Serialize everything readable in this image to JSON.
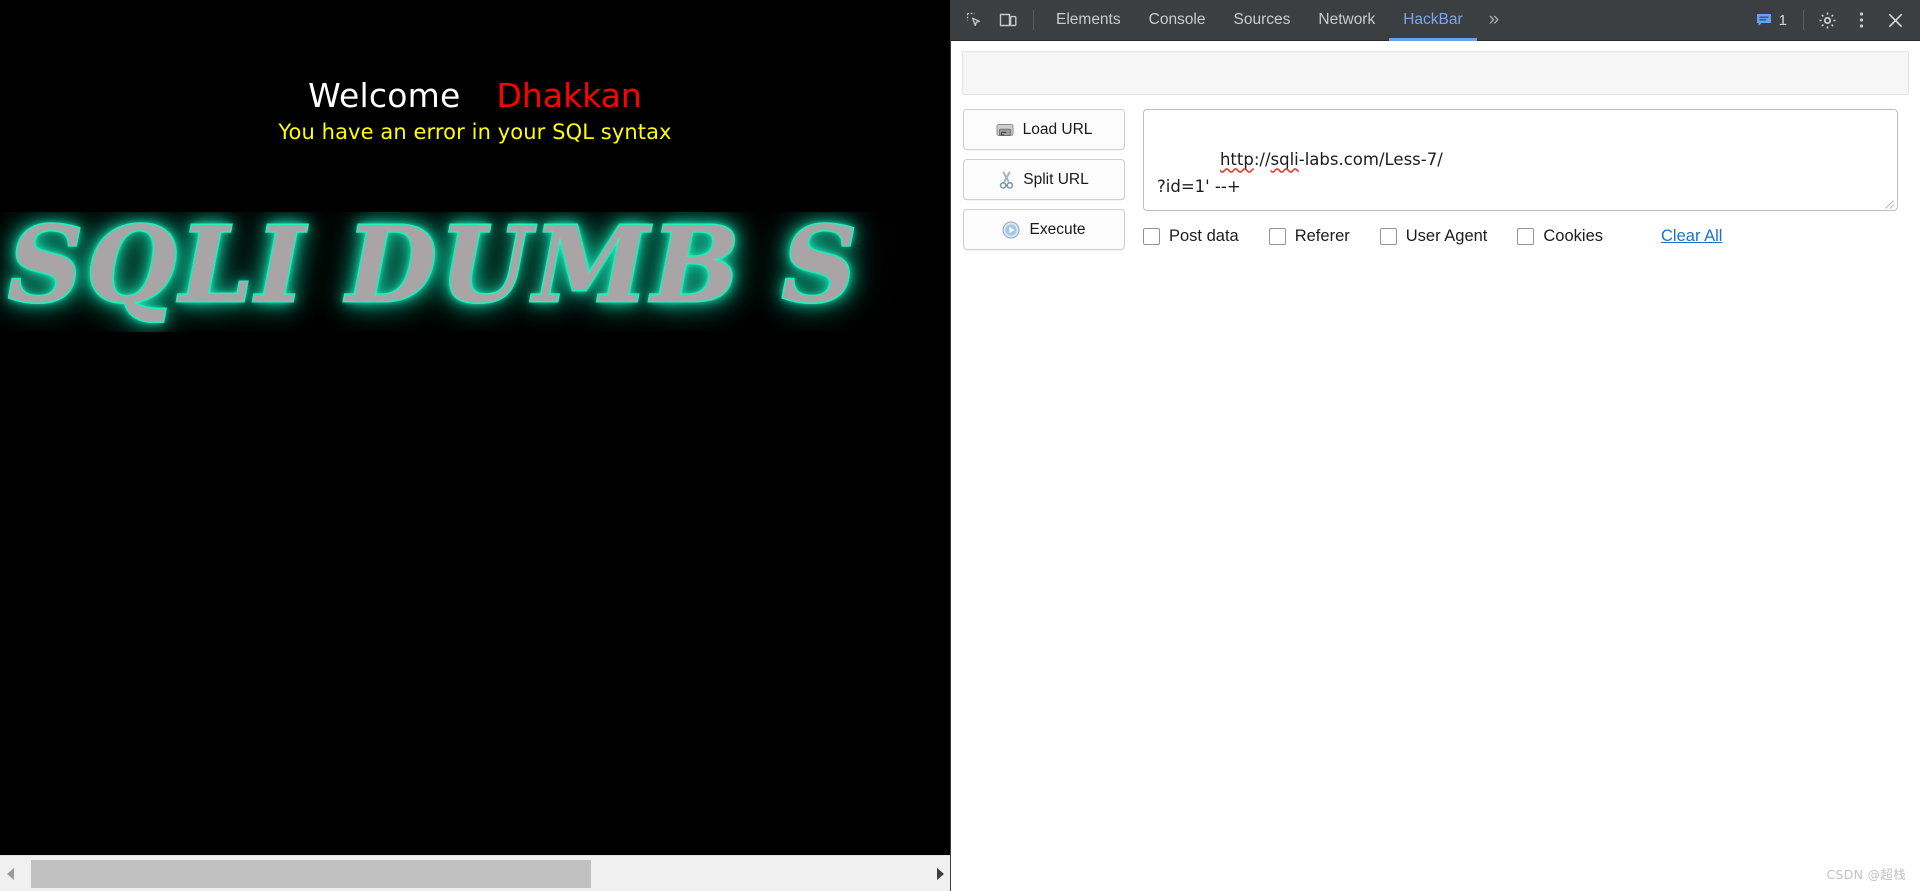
{
  "page": {
    "heading": {
      "welcome": "Welcome",
      "name": "Dhakkan"
    },
    "error_message": "You have an error in your SQL syntax",
    "banner_text": "SQLI DUMB S",
    "banner_colors": {
      "glow": "#2affc8",
      "metal": "#a9a4a6",
      "background": "#000000"
    },
    "text_colors": {
      "welcome": "#ffffff",
      "name": "#ff0000",
      "error": "#ffff00"
    },
    "scrollbar": {
      "left_arrow_icon": "chevron-left-icon",
      "right_arrow_icon": "chevron-right-icon"
    }
  },
  "devtools": {
    "toolbar": {
      "inspect_icon": "inspect-element-icon",
      "device_icon": "device-toolbar-icon",
      "tabs": [
        {
          "label": "Elements",
          "active": false
        },
        {
          "label": "Console",
          "active": false
        },
        {
          "label": "Sources",
          "active": false
        },
        {
          "label": "Network",
          "active": false
        },
        {
          "label": "HackBar",
          "active": true
        }
      ],
      "more_tabs_icon": "chevron-double-right-icon",
      "message_icon": "message-badge-icon",
      "message_count": "1",
      "settings_icon": "gear-icon",
      "menu_icon": "kebab-menu-icon",
      "close_icon": "close-icon",
      "active_tab_accent": "#6b9eeb",
      "background": "#3c3f41"
    },
    "hackbar": {
      "buttons": [
        {
          "label": "Load URL",
          "icon": "load-url-icon"
        },
        {
          "label": "Split URL",
          "icon": "scissors-icon"
        },
        {
          "label": "Execute",
          "icon": "play-icon"
        }
      ],
      "url_field": {
        "line1_prefix": "http",
        "line1_mid": "://",
        "line1_word": "sqli",
        "line1_suffix": "-labs.com/Less-7/",
        "line2": "?id=1' --+",
        "value": "http://sqli-labs.com/Less-7/\n?id=1' --+",
        "placeholder": ""
      },
      "checkboxes": [
        {
          "label": "Post data",
          "checked": false
        },
        {
          "label": "Referer",
          "checked": false
        },
        {
          "label": "User Agent",
          "checked": false
        },
        {
          "label": "Cookies",
          "checked": false
        }
      ],
      "clear_all_label": "Clear All",
      "clear_all_color": "#1a73c9"
    }
  },
  "watermark": "CSDN @超栈"
}
